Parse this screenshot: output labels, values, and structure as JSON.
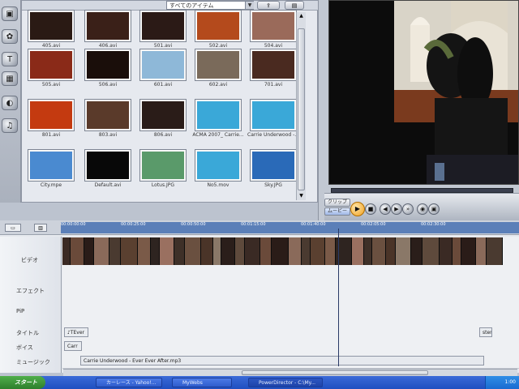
{
  "library": {
    "filter_label": "すべてのアイテム",
    "items": [
      {
        "label": "405.avi",
        "color": "#2a1a14"
      },
      {
        "label": "406.avi",
        "color": "#3a2018"
      },
      {
        "label": "501.avi",
        "color": "#2b1a16"
      },
      {
        "label": "502.avi",
        "color": "#b44a1c"
      },
      {
        "label": "504.avi",
        "color": "#9a6a5a"
      },
      {
        "label": "505.avi",
        "color": "#8a2a18"
      },
      {
        "label": "506.avi",
        "color": "#1a0e0a"
      },
      {
        "label": "601.avi",
        "color": "#8eb8d8"
      },
      {
        "label": "602.avi",
        "color": "#7a6a5a"
      },
      {
        "label": "701.avi",
        "color": "#4a2a20"
      },
      {
        "label": "801.avi",
        "color": "#c43a10"
      },
      {
        "label": "803.avi",
        "color": "#5a3a2a"
      },
      {
        "label": "806.avi",
        "color": "#2a1c18"
      },
      {
        "label": "ACMA 2007_ Carrie...",
        "color": "#3aa8d8"
      },
      {
        "label": "Carrie Underwood -...",
        "color": "#3aa8d8"
      },
      {
        "label": "City.mpe",
        "color": "#4a8ad0"
      },
      {
        "label": "Default.avi",
        "color": "#080808"
      },
      {
        "label": "Lotus.JPG",
        "color": "#5a9a6a"
      },
      {
        "label": "No5.mov",
        "color": "#3aa8d8"
      },
      {
        "label": "Sky.JPG",
        "color": "#2a6ab8"
      }
    ]
  },
  "preview": {
    "mode_clip": "クリップ",
    "mode_movie": "ムービー"
  },
  "timeline": {
    "ruler_ticks": [
      "00:00:00:00",
      "00:00:25:00",
      "00:00:50:00",
      "00:01:15:00",
      "00:01:40:00",
      "00:02:05:00",
      "00:02:30:00"
    ],
    "tracks": [
      "ビデオ",
      "エフェクト",
      "PiP",
      "タイトル",
      "ボイス",
      "ミュージック"
    ],
    "title_clip": "♪TEver",
    "title_clip_end": "ster",
    "voice_clip": "Carr",
    "music_clip": "Carrie Underwood - Ever Ever After.mp3"
  },
  "taskbar": {
    "start": "スタート",
    "tasks": [
      "カーレース - Yahoo!...",
      "MyWebs",
      "PowerDirector - C:\\My..."
    ],
    "clock": "1:00"
  }
}
